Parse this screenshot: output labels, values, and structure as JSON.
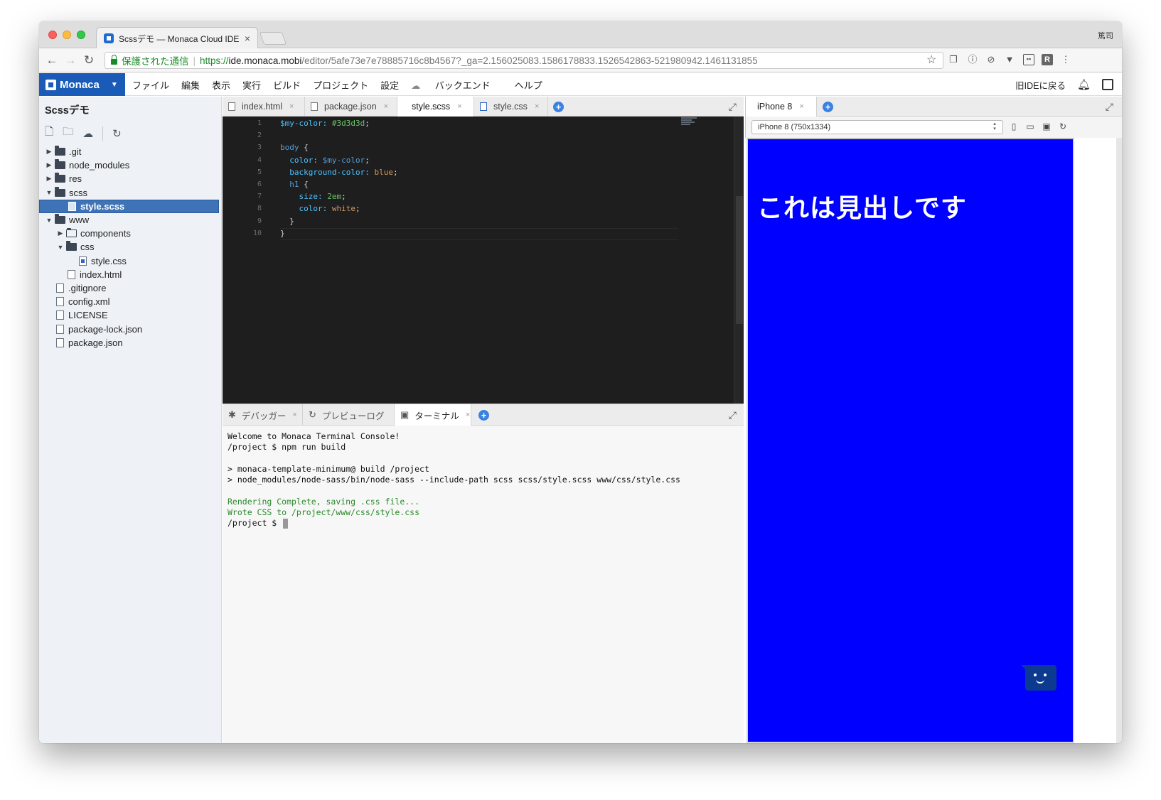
{
  "browser": {
    "tab_title": "Scssデモ — Monaca Cloud IDE",
    "tab_close": "×",
    "profile_name": "篤司",
    "nav": {
      "back": "←",
      "forward": "→",
      "reload": "↻"
    },
    "secure_label": "保護された通信",
    "url_scheme": "https://",
    "url_host": "ide.monaca.mobi",
    "url_rest": "/editor/5afe73e7e78885716c8b4567?_ga=2.156025083.1586178833.1526542863-521980942.1461131855",
    "ext_r": "R"
  },
  "menubar": {
    "logo": "Monaca",
    "logo_caret": "▼",
    "items": [
      "ファイル",
      "編集",
      "表示",
      "実行",
      "ビルド",
      "プロジェクト",
      "設定",
      "バックエンド",
      "ヘルプ"
    ],
    "backend_icon": "cloud-icon",
    "old_ide": "旧IDEに戻る"
  },
  "sidebar": {
    "project_title": "Scssデモ",
    "tree": [
      {
        "label": ".git",
        "type": "folder",
        "expanded": false,
        "depth": 0
      },
      {
        "label": "node_modules",
        "type": "folder",
        "expanded": false,
        "depth": 0
      },
      {
        "label": "res",
        "type": "folder",
        "expanded": false,
        "depth": 0
      },
      {
        "label": "scss",
        "type": "folder",
        "expanded": true,
        "depth": 0
      },
      {
        "label": "style.scss",
        "type": "file",
        "depth": 1,
        "selected": true
      },
      {
        "label": "www",
        "type": "folder",
        "expanded": true,
        "depth": 0
      },
      {
        "label": "components",
        "type": "folder-js",
        "expanded": false,
        "depth": 1
      },
      {
        "label": "css",
        "type": "folder",
        "expanded": true,
        "depth": 1
      },
      {
        "label": "style.css",
        "type": "file-css",
        "depth": 2
      },
      {
        "label": "index.html",
        "type": "file",
        "depth": 1
      },
      {
        "label": ".gitignore",
        "type": "file",
        "depth": 0
      },
      {
        "label": "config.xml",
        "type": "file",
        "depth": 0
      },
      {
        "label": "LICENSE",
        "type": "file",
        "depth": 0
      },
      {
        "label": "package-lock.json",
        "type": "file",
        "depth": 0
      },
      {
        "label": "package.json",
        "type": "file",
        "depth": 0
      }
    ]
  },
  "editor": {
    "tabs": [
      {
        "label": "index.html",
        "active": false
      },
      {
        "label": "package.json",
        "active": false
      },
      {
        "label": "style.scss",
        "active": true
      },
      {
        "label": "style.css",
        "active": false
      }
    ],
    "tab_close": "×",
    "colors": {
      "variable": "#9cdcfe",
      "value_green": "#6bc46b",
      "selector": "#569cd6",
      "property": "#4fc1ff",
      "keyword_value": "#d19a66",
      "white": "#d4d4d4"
    },
    "lines": [
      {
        "n": "1",
        "tokens": [
          {
            "t": "$my-color: ",
            "c": "property"
          },
          {
            "t": "#3d3d3d",
            "c": "value_green"
          },
          {
            "t": ";",
            "c": "white"
          }
        ]
      },
      {
        "n": "2",
        "tokens": []
      },
      {
        "n": "3",
        "tokens": [
          {
            "t": "body ",
            "c": "selector"
          },
          {
            "t": "{",
            "c": "white"
          }
        ]
      },
      {
        "n": "4",
        "tokens": [
          {
            "t": "  color: ",
            "c": "property"
          },
          {
            "t": "$my-color",
            "c": "selector"
          },
          {
            "t": ";",
            "c": "white"
          }
        ]
      },
      {
        "n": "5",
        "tokens": [
          {
            "t": "  background-color: ",
            "c": "property"
          },
          {
            "t": "blue",
            "c": "keyword_value"
          },
          {
            "t": ";",
            "c": "white"
          }
        ]
      },
      {
        "n": "6",
        "tokens": [
          {
            "t": "  h1 ",
            "c": "selector"
          },
          {
            "t": "{",
            "c": "white"
          }
        ]
      },
      {
        "n": "7",
        "tokens": [
          {
            "t": "    size: ",
            "c": "property"
          },
          {
            "t": "2em",
            "c": "value_green"
          },
          {
            "t": ";",
            "c": "white"
          }
        ]
      },
      {
        "n": "8",
        "tokens": [
          {
            "t": "    color: ",
            "c": "property"
          },
          {
            "t": "white",
            "c": "keyword_value"
          },
          {
            "t": ";",
            "c": "white"
          }
        ]
      },
      {
        "n": "9",
        "tokens": [
          {
            "t": "  }",
            "c": "white"
          }
        ]
      },
      {
        "n": "10",
        "tokens": [
          {
            "t": "}",
            "c": "white"
          }
        ]
      }
    ]
  },
  "bottom_panel": {
    "tabs": [
      {
        "label": "デバッガー",
        "icon": "bug-icon",
        "active": false
      },
      {
        "label": "プレビューログ",
        "icon": "refresh-icon",
        "active": false
      },
      {
        "label": "ターミナル",
        "icon": "terminal-icon",
        "active": true
      }
    ],
    "tab_close": "×",
    "terminal_lines": [
      {
        "text": "Welcome to Monaca Terminal Console!",
        "style": "normal"
      },
      {
        "text": "/project $ npm run build",
        "style": "normal"
      },
      {
        "text": "",
        "style": "normal"
      },
      {
        "text": "> monaca-template-minimum@ build /project",
        "style": "normal"
      },
      {
        "text": "> node_modules/node-sass/bin/node-sass --include-path scss scss/style.scss www/css/style.css",
        "style": "normal"
      },
      {
        "text": "",
        "style": "normal"
      },
      {
        "text": "Rendering Complete, saving .css file...",
        "style": "green"
      },
      {
        "text": "Wrote CSS to /project/www/css/style.css",
        "style": "green"
      }
    ],
    "prompt": "/project $ "
  },
  "preview": {
    "tab_label": "iPhone 8",
    "tab_close": "×",
    "device_select": "iPhone 8 (750x1334)",
    "heading": "これは見出しです",
    "background_color": "#0000ff",
    "heading_color": "#ffffff"
  }
}
